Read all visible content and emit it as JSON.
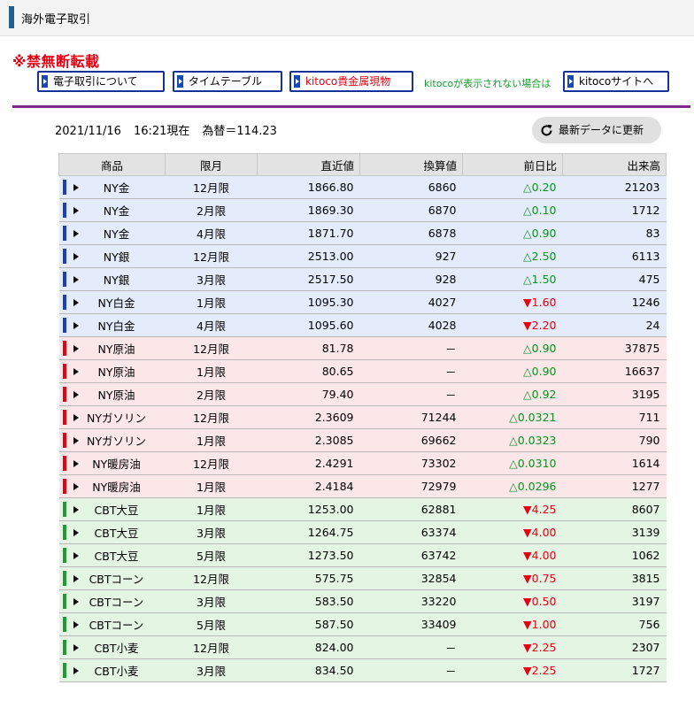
{
  "header": {
    "title": "海外電子取引"
  },
  "notice": "※禁無断転載",
  "nav": [
    {
      "label": "電子取引について"
    },
    {
      "label": "タイムテーブル"
    },
    {
      "label": "kitoco貴金属現物"
    },
    {
      "label": "kitocoサイトへ"
    }
  ],
  "green_note": "kitocoが表示されない場合は",
  "timestamp": {
    "date": "2021/11/16",
    "time": "16:21現在",
    "fx": "為替＝114.23"
  },
  "refresh_label": "最新データに更新",
  "colors": {
    "blue_row": "#e4ecfb",
    "red_row": "#fbe7e8",
    "green_row": "#e5f5e3",
    "up": "#0e8f22",
    "down": "#e60012",
    "accent": "#7a2c88"
  },
  "table": {
    "headers": [
      "商品",
      "限月",
      "直近値",
      "換算値",
      "前日比",
      "出来高"
    ],
    "rows": [
      {
        "group": "blue",
        "name": "NY金",
        "month": "12月限",
        "price": "1866.80",
        "conv": "6860",
        "dir": "up",
        "change": "△0.20",
        "vol": "21203"
      },
      {
        "group": "blue",
        "name": "NY金",
        "month": "2月限",
        "price": "1869.30",
        "conv": "6870",
        "dir": "up",
        "change": "△0.10",
        "vol": "1712"
      },
      {
        "group": "blue",
        "name": "NY金",
        "month": "4月限",
        "price": "1871.70",
        "conv": "6878",
        "dir": "up",
        "change": "△0.90",
        "vol": "83"
      },
      {
        "group": "blue",
        "name": "NY銀",
        "month": "12月限",
        "price": "2513.00",
        "conv": "927",
        "dir": "up",
        "change": "△2.50",
        "vol": "6113"
      },
      {
        "group": "blue",
        "name": "NY銀",
        "month": "3月限",
        "price": "2517.50",
        "conv": "928",
        "dir": "up",
        "change": "△1.50",
        "vol": "475"
      },
      {
        "group": "blue",
        "name": "NY白金",
        "month": "1月限",
        "price": "1095.30",
        "conv": "4027",
        "dir": "down",
        "change": "▼1.60",
        "vol": "1246"
      },
      {
        "group": "blue",
        "name": "NY白金",
        "month": "4月限",
        "price": "1095.60",
        "conv": "4028",
        "dir": "down",
        "change": "▼2.20",
        "vol": "24"
      },
      {
        "group": "red",
        "name": "NY原油",
        "month": "12月限",
        "price": "81.78",
        "conv": "－",
        "dir": "up",
        "change": "△0.90",
        "vol": "37875"
      },
      {
        "group": "red",
        "name": "NY原油",
        "month": "1月限",
        "price": "80.65",
        "conv": "－",
        "dir": "up",
        "change": "△0.90",
        "vol": "16637"
      },
      {
        "group": "red",
        "name": "NY原油",
        "month": "2月限",
        "price": "79.40",
        "conv": "－",
        "dir": "up",
        "change": "△0.92",
        "vol": "3195"
      },
      {
        "group": "red",
        "name": "NYガソリン",
        "month": "12月限",
        "price": "2.3609",
        "conv": "71244",
        "dir": "up",
        "change": "△0.0321",
        "vol": "711"
      },
      {
        "group": "red",
        "name": "NYガソリン",
        "month": "1月限",
        "price": "2.3085",
        "conv": "69662",
        "dir": "up",
        "change": "△0.0323",
        "vol": "790"
      },
      {
        "group": "red",
        "name": "NY暖房油",
        "month": "12月限",
        "price": "2.4291",
        "conv": "73302",
        "dir": "up",
        "change": "△0.0310",
        "vol": "1614"
      },
      {
        "group": "red",
        "name": "NY暖房油",
        "month": "1月限",
        "price": "2.4184",
        "conv": "72979",
        "dir": "up",
        "change": "△0.0296",
        "vol": "1277"
      },
      {
        "group": "green",
        "name": "CBT大豆",
        "month": "1月限",
        "price": "1253.00",
        "conv": "62881",
        "dir": "down",
        "change": "▼4.25",
        "vol": "8607"
      },
      {
        "group": "green",
        "name": "CBT大豆",
        "month": "3月限",
        "price": "1264.75",
        "conv": "63374",
        "dir": "down",
        "change": "▼4.00",
        "vol": "3139"
      },
      {
        "group": "green",
        "name": "CBT大豆",
        "month": "5月限",
        "price": "1273.50",
        "conv": "63742",
        "dir": "down",
        "change": "▼4.00",
        "vol": "1062"
      },
      {
        "group": "green",
        "name": "CBTコーン",
        "month": "12月限",
        "price": "575.75",
        "conv": "32854",
        "dir": "down",
        "change": "▼0.75",
        "vol": "3815"
      },
      {
        "group": "green",
        "name": "CBTコーン",
        "month": "3月限",
        "price": "583.50",
        "conv": "33220",
        "dir": "down",
        "change": "▼0.50",
        "vol": "3197"
      },
      {
        "group": "green",
        "name": "CBTコーン",
        "month": "5月限",
        "price": "587.50",
        "conv": "33409",
        "dir": "down",
        "change": "▼1.00",
        "vol": "756"
      },
      {
        "group": "green",
        "name": "CBT小麦",
        "month": "12月限",
        "price": "824.00",
        "conv": "－",
        "dir": "down",
        "change": "▼2.25",
        "vol": "2307"
      },
      {
        "group": "green",
        "name": "CBT小麦",
        "month": "3月限",
        "price": "834.50",
        "conv": "－",
        "dir": "down",
        "change": "▼2.25",
        "vol": "1727"
      }
    ]
  }
}
